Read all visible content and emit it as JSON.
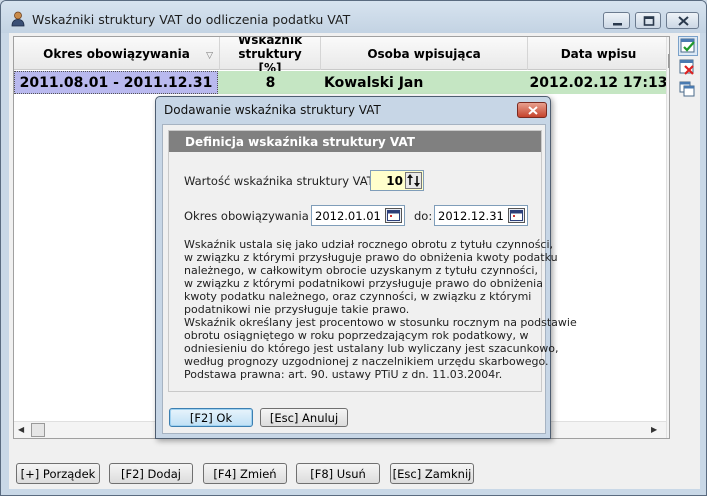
{
  "window": {
    "title": "Wskaźniki struktury VAT do odliczenia podatku VAT"
  },
  "grid": {
    "columns": [
      "Okres obowiązywania",
      "Wskaźnik struktury [%]",
      "Osoba wpisująca",
      "Data wpisu"
    ],
    "rows": [
      {
        "okres": "2011.08.01 - 2011.12.31",
        "wskaznik": "8",
        "osoba": "Kowalski Jan",
        "data": "2012.02.12 17:13"
      }
    ]
  },
  "buttons": {
    "porzadek": "[+] Porządek",
    "dodaj": "[F2] Dodaj",
    "zmien": "[F4] Zmień",
    "usun": "[F8] Usuń",
    "zamknij": "[Esc] Zamknij"
  },
  "dialog": {
    "title": "Dodawanie wskaźnika struktury VAT",
    "group_title": "Definicja wskaźnika struktury VAT",
    "value_label": "Wartość wskaźnika struktury VAT [%]:",
    "value": "10",
    "period_label": "Okres obowiązywania od:",
    "date_from": "2012.01.01",
    "to_label": "do:",
    "date_to": "2012.12.31",
    "description": [
      "Wskaźnik ustala się jako udział rocznego obrotu z tytułu czynności,",
      "w związku z którymi przysługuje prawo do obniżenia kwoty podatku",
      "należnego, w całkowitym obrocie uzyskanym z tytułu czynności,",
      "w związku z którymi podatnikowi przysługuje prawo do obniżenia",
      "kwoty podatku należnego, oraz czynności, w związku z którymi",
      "podatnikowi nie przysługuje takie prawo.",
      "Wskaźnik określany jest procentowo w stosunku rocznym na podstawie",
      "obrotu osiągniętego w roku poprzedzającym rok podatkowy, w",
      "odniesieniu do którego jest ustalany lub wyliczany jest szacunkowo,",
      "według prognozy uzgodnionej z naczelnikiem urzędu skarbowego.",
      "Podstawa prawna: art. 90. ustawy PTiU z dn. 11.03.2004r."
    ],
    "ok": "[F2] Ok",
    "cancel": "[Esc] Anuluj"
  },
  "icons": {
    "app": "user-icon",
    "sort": "sort-desc-icon",
    "toolbar": [
      "select-check-icon",
      "delete-x-icon",
      "copy-window-icon"
    ]
  },
  "colors": {
    "row_green": "#c5e6c3",
    "row_selected": "#b9b9ee",
    "dialog_close": "#c5432c"
  }
}
